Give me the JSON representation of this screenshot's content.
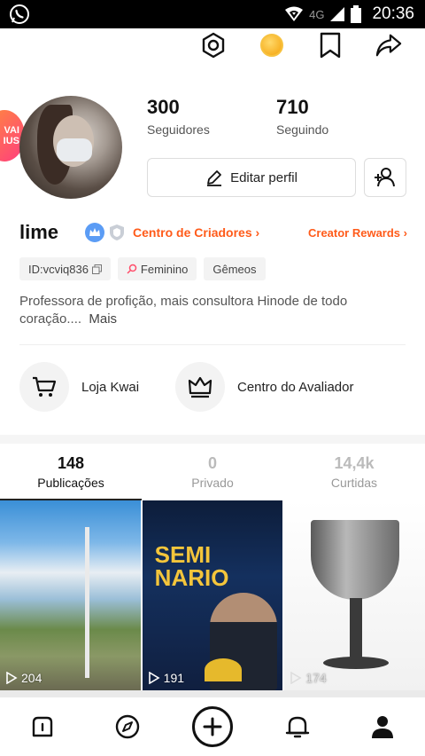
{
  "status_bar": {
    "time": "20:36",
    "network": "4G"
  },
  "top_icons": [
    "settings-icon",
    "coin-icon",
    "bookmark-icon",
    "share-icon"
  ],
  "profile": {
    "badge_text": "VAI\nIUS",
    "followers_count": "300",
    "followers_label": "Seguidores",
    "following_count": "710",
    "following_label": "Seguindo",
    "edit_label": "Editar perfil",
    "name": "lime",
    "creators_link": "Centro de Criadores",
    "rewards_link": "Creator Rewards",
    "tags": [
      "ID:vcviq836",
      "Feminino",
      "Gêmeos"
    ],
    "bio": "Professora de profição, mais consultora Hinode de todo coração....",
    "bio_more": "Mais"
  },
  "features": [
    {
      "label": "Loja Kwai"
    },
    {
      "label": "Centro do Avaliador"
    }
  ],
  "tabs": [
    {
      "count": "148",
      "label": "Publicações"
    },
    {
      "count": "0",
      "label": "Privado"
    },
    {
      "count": "14,4k",
      "label": "Curtidas"
    }
  ],
  "posts": [
    {
      "views": "204"
    },
    {
      "views": "191",
      "headline": "SEMI\nNARIO"
    },
    {
      "views": "174"
    }
  ],
  "colors": {
    "accent": "#ff5b1a",
    "verified": "#5b9cf5"
  }
}
